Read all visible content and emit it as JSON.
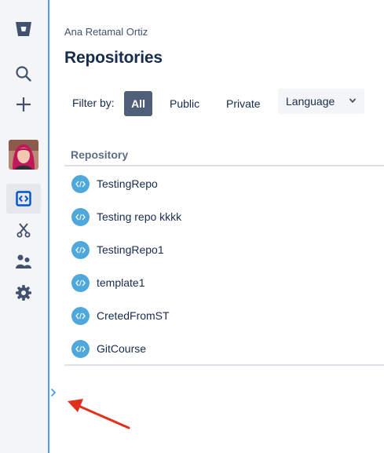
{
  "user": {
    "name": "Ana Retamal Ortiz"
  },
  "page": {
    "title": "Repositories"
  },
  "sidebar": {
    "items": [
      {
        "id": "bitbucket",
        "icon": "bitbucket-logo-icon"
      },
      {
        "id": "search",
        "icon": "search-icon"
      },
      {
        "id": "create",
        "icon": "plus-icon"
      },
      {
        "id": "profile",
        "icon": "avatar"
      },
      {
        "id": "repositories",
        "icon": "code-icon",
        "active": true
      },
      {
        "id": "snippets",
        "icon": "scissors-icon"
      },
      {
        "id": "teams",
        "icon": "people-icon"
      },
      {
        "id": "settings",
        "icon": "gear-icon"
      }
    ]
  },
  "filter": {
    "label": "Filter by:",
    "options": [
      "All",
      "Public",
      "Private"
    ],
    "selected": "All",
    "language_select": "Language"
  },
  "table": {
    "header": "Repository",
    "rows": [
      {
        "name": "TestingRepo"
      },
      {
        "name": "Testing repo kkkk"
      },
      {
        "name": "TestingRepo1"
      },
      {
        "name": "template1"
      },
      {
        "name": "CretedFromST"
      },
      {
        "name": "GitCourse"
      }
    ]
  },
  "colors": {
    "accent": "#4c9aff",
    "repo_icon": "#4fa8dc",
    "selected_filter": "#505f79",
    "annotation_arrow": "#e0311e"
  }
}
